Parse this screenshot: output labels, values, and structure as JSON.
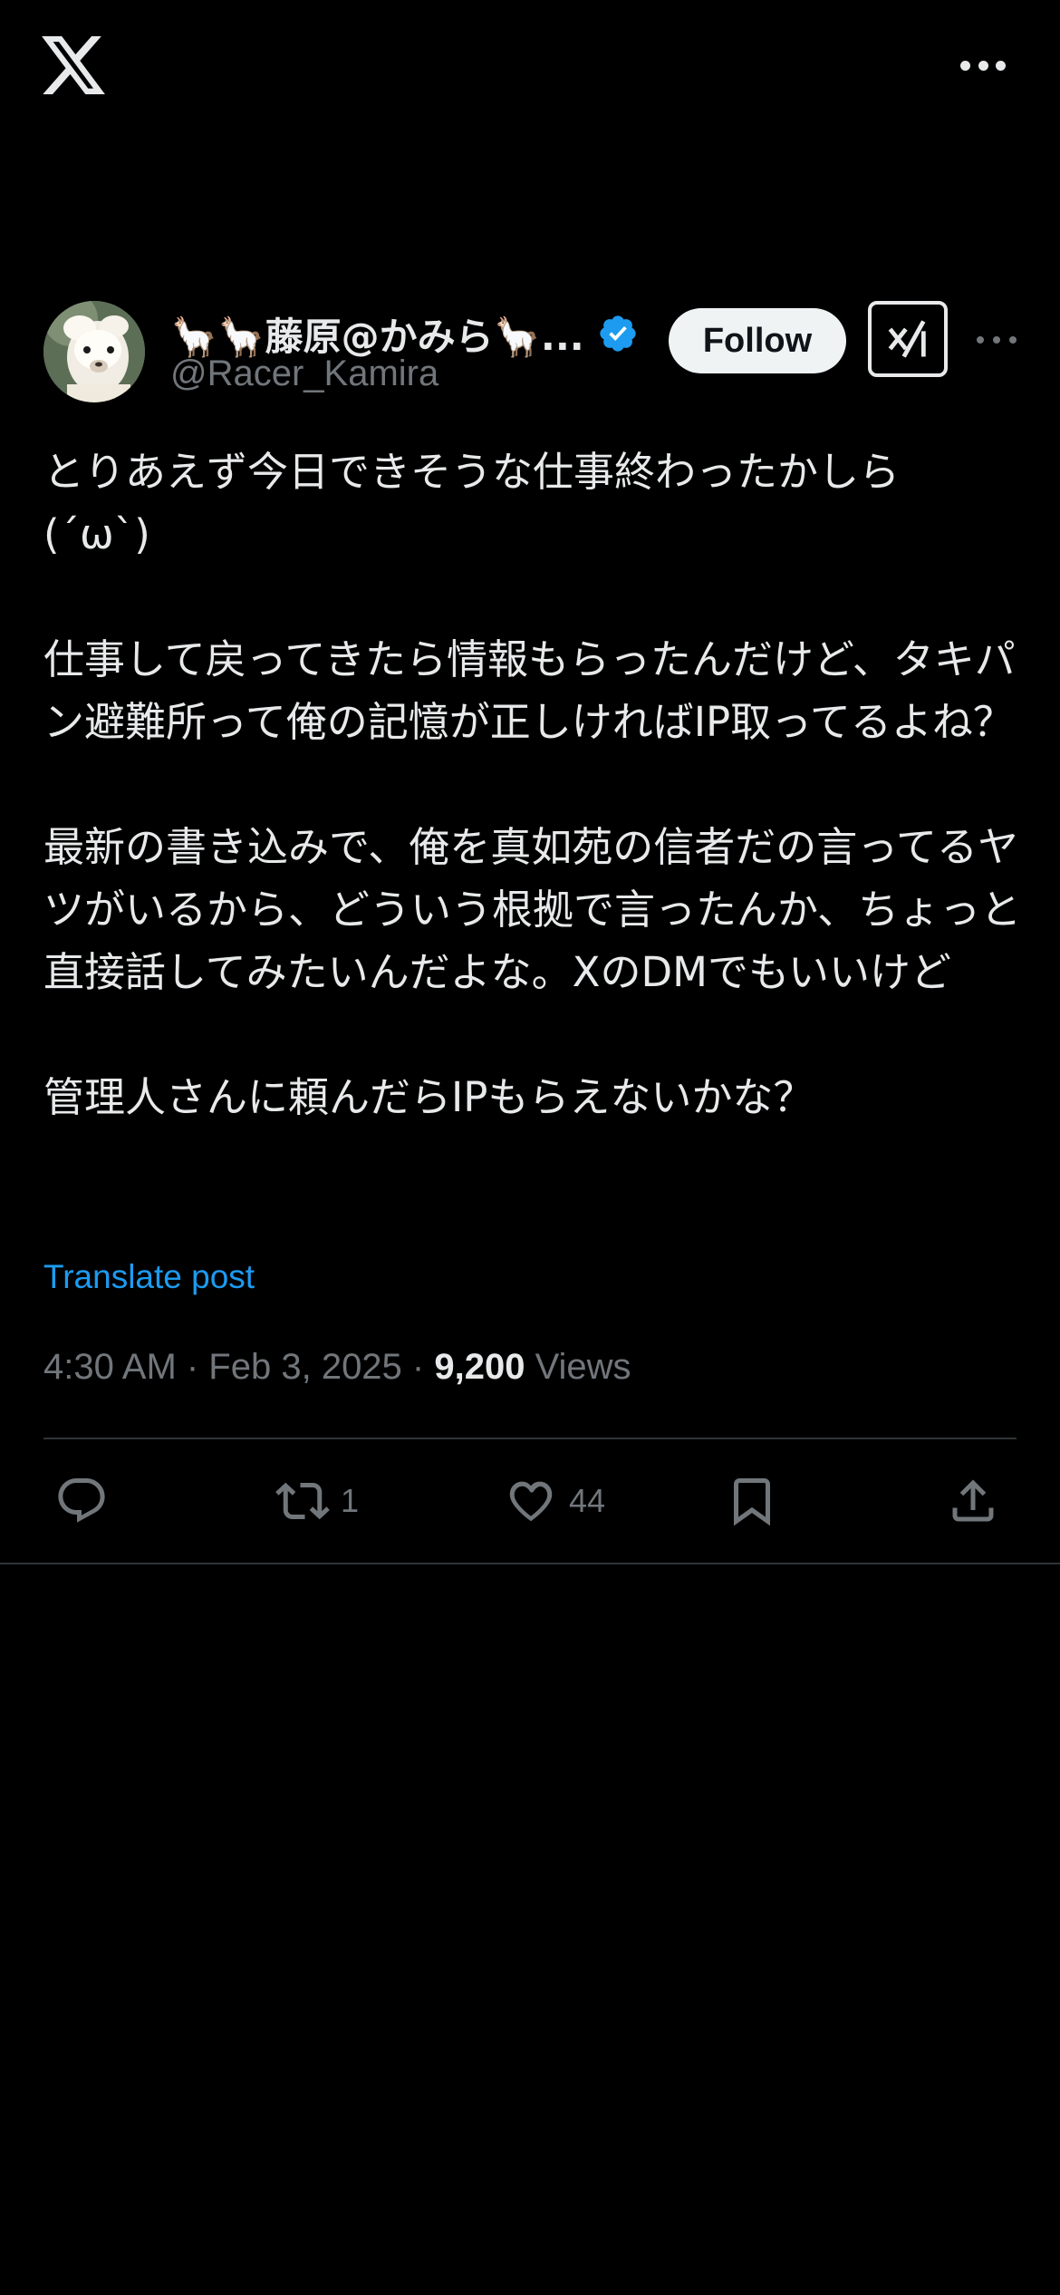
{
  "topbar": {
    "logo_icon": "x-logo-icon",
    "more_icon": "more-horizontal-icon"
  },
  "post": {
    "author": {
      "display_name": "🦙🦙藤原@かみら🦙...",
      "handle": "@Racer_Kamira",
      "verified": true,
      "avatar_icon": "alpaca-avatar"
    },
    "follow_label": "Follow",
    "grok_icon": "grok-icon",
    "more_icon": "more-horizontal-icon",
    "text": "とりあえず今日できそうな仕事終わったかしら\n(´ω`)\n\n仕事して戻ってきたら情報もらったんだけど、タキパン避難所って俺の記憶が正しければIP取ってるよね？\n\n最新の書き込みで、俺を真如苑の信者だの言ってるヤツがいるから、どういう根拠で言ったんか、ちょっと直接話してみたいんだよな。XのDMでもいいけど\n\n管理人さんに頼んだらIPもらえないかな？",
    "translate_label": "Translate post",
    "timestamp": "4:30 AM · Feb 3, 2025 · ",
    "views_count": "9,200",
    "views_label": " Views",
    "actions": {
      "reply_count": "",
      "repost_count": "1",
      "like_count": "44"
    }
  },
  "colors": {
    "accent": "#1d9bf0",
    "background": "#000000",
    "text": "#e7e9ea",
    "muted": "#71767b",
    "verified": "#1d9bf0"
  }
}
